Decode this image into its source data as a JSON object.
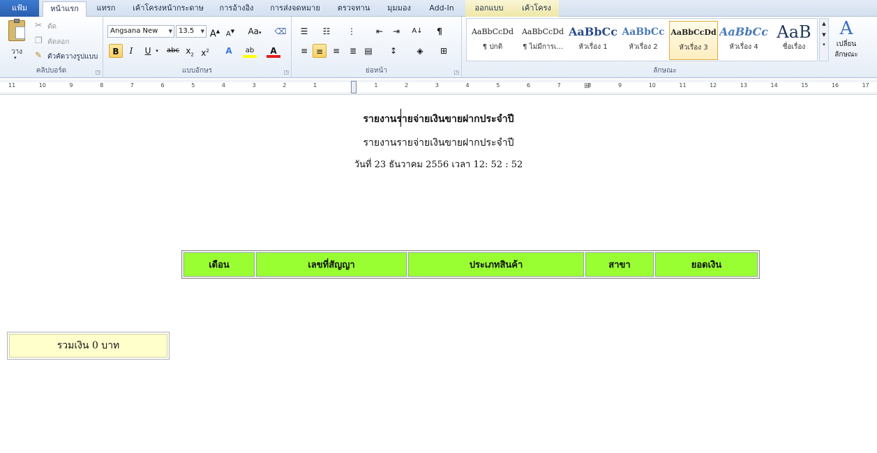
{
  "tabs": {
    "file": "แฟ้ม",
    "home": "หน้าแรก",
    "insert": "แทรก",
    "page_layout": "เค้าโครงหน้ากระดาษ",
    "references": "การอ้างอิง",
    "mailings": "การส่งจดหมาย",
    "review": "ตรวจทาน",
    "view": "มุมมอง",
    "addin": "Add-In",
    "design": "ออกแบบ",
    "layout": "เค้าโครง"
  },
  "clipboard": {
    "paste": "วาง",
    "cut": "ตัด",
    "copy": "คัดลอก",
    "format_painter": "ตัวคัดวางรูปแบบ",
    "label": "คลิปบอร์ด"
  },
  "font": {
    "name": "Angsana New",
    "size": "13.5",
    "label": "แบบอักษร"
  },
  "paragraph": {
    "label": "ย่อหน้า"
  },
  "styles": {
    "label": "ลักษณะ",
    "items": [
      {
        "sample": "AaBbCcDd",
        "name": "¶ ปกติ"
      },
      {
        "sample": "AaBbCcDd",
        "name": "¶ ไม่มีการเ..."
      },
      {
        "sample": "AaBbCc",
        "name": "หัวเรื่อง 1"
      },
      {
        "sample": "AaBbCc",
        "name": "หัวเรื่อง 2"
      },
      {
        "sample": "AaBbCcDd",
        "name": "หัวเรื่อง 3"
      },
      {
        "sample": "AaBbCc",
        "name": "หัวเรื่อง 4"
      },
      {
        "sample": "AaB",
        "name": "ชื่อเรื่อง"
      }
    ],
    "change_styles_line1": "เปลี่ยน",
    "change_styles_line2": "ลักษณะ"
  },
  "ruler": [
    "11",
    "10",
    "9",
    "8",
    "7",
    "6",
    "5",
    "4",
    "3",
    "2",
    "1",
    "1",
    "2",
    "3",
    "4",
    "5",
    "6",
    "7",
    "8",
    "9",
    "10",
    "11",
    "12",
    "13",
    "14",
    "15",
    "16",
    "17"
  ],
  "document": {
    "title": "รายงานรายจ่ายเงินขายฝากประจำปี",
    "subtitle": "รายงานรายจ่ายเงินขายฝากประจำปี",
    "date_line": "วันที่ 23 ธันวาคม 2556 เวลา 12: 52 : 52",
    "table_headers": [
      "เดือน",
      "เลขที่สัญญา",
      "ประเภทสินค้า",
      "สาขา",
      "ยอดเงิน"
    ],
    "total": "รวมเงิน 0 บาท"
  },
  "colors": {
    "table_header_bg": "#99ff33",
    "total_bg": "#ffffcc",
    "file_tab": "#2a5fae"
  }
}
